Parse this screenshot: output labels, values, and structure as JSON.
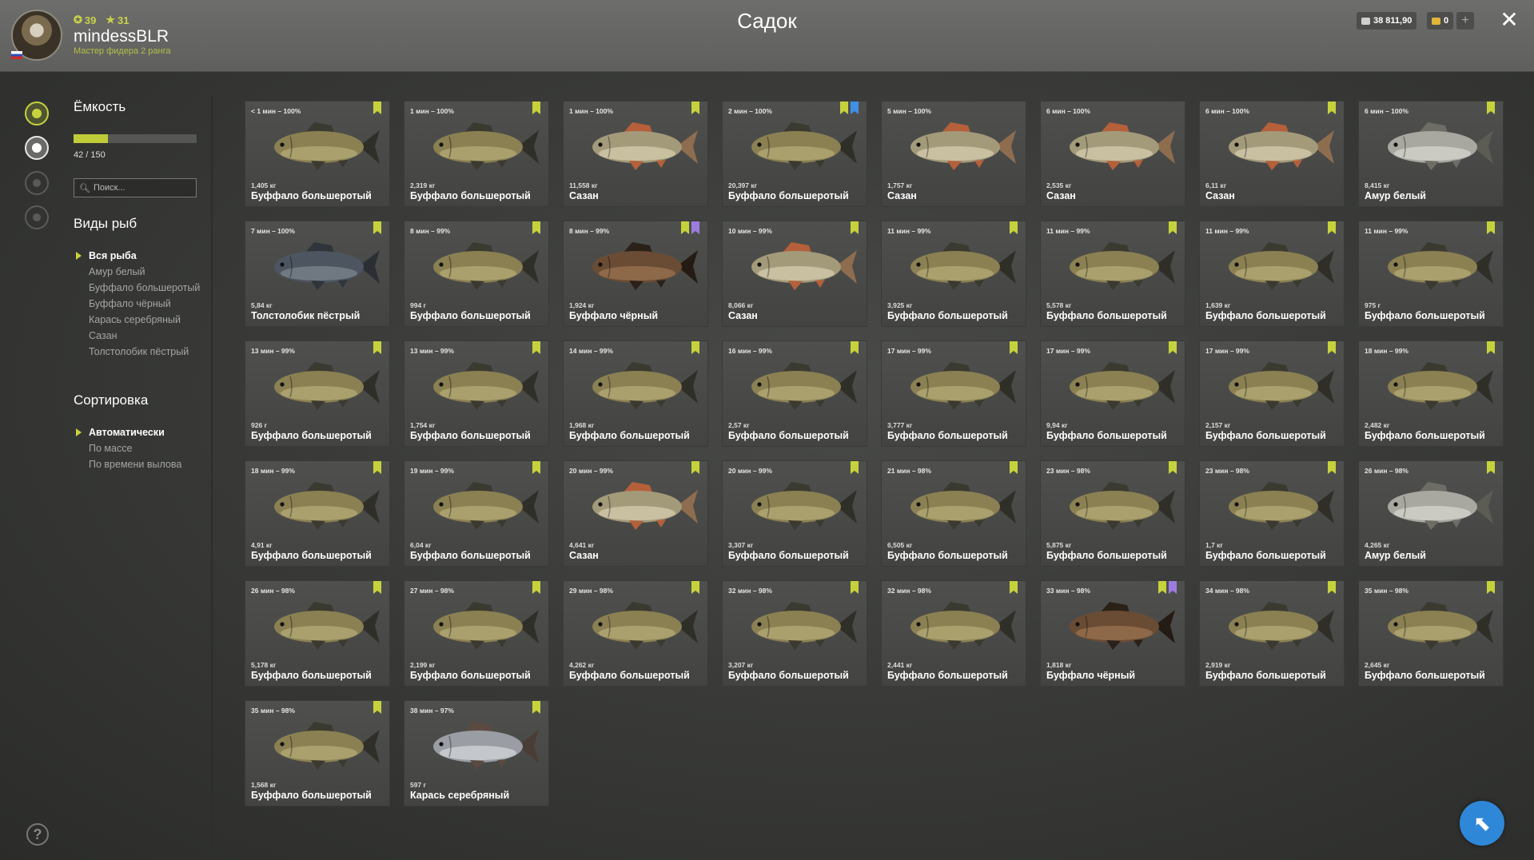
{
  "window": {
    "title": "Садок"
  },
  "player": {
    "username": "mindessBLR",
    "rank": "Мастер фидера 2 ранга",
    "level": "39",
    "stars": "31"
  },
  "currency": {
    "silver": "38 811,90",
    "gold": "0",
    "add_label": "+"
  },
  "sidebar": {
    "capacity_title": "Ёмкость",
    "capacity_count": "42 / 150",
    "capacity_fraction": 0.28,
    "search_placeholder": "Поиск...",
    "species_title": "Виды рыб",
    "species": [
      {
        "label": "Вся рыба",
        "selected": true
      },
      {
        "label": "Амур белый",
        "selected": false
      },
      {
        "label": "Буффало большеротый",
        "selected": false
      },
      {
        "label": "Буффало чёрный",
        "selected": false
      },
      {
        "label": "Карась серебряный",
        "selected": false
      },
      {
        "label": "Сазан",
        "selected": false
      },
      {
        "label": "Толстолобик пёстрый",
        "selected": false
      }
    ],
    "sort_title": "Сортировка",
    "sort": [
      {
        "label": "Автоматически",
        "selected": true
      },
      {
        "label": "По массе",
        "selected": false
      },
      {
        "label": "По времени вылова",
        "selected": false
      }
    ]
  },
  "fish": [
    {
      "time": "< 1 мин – 100%",
      "weight": "1,405 кг",
      "name": "Буффало большеротый",
      "kind": "buffalo",
      "tags": [
        "green"
      ]
    },
    {
      "time": "1 мин – 100%",
      "weight": "2,319 кг",
      "name": "Буффало большеротый",
      "kind": "buffalo",
      "tags": [
        "green"
      ]
    },
    {
      "time": "1 мин – 100%",
      "weight": "11,558 кг",
      "name": "Сазан",
      "kind": "carp",
      "tags": [
        "green"
      ]
    },
    {
      "time": "2 мин – 100%",
      "weight": "20,397 кг",
      "name": "Буффало большеротый",
      "kind": "buffalo",
      "tags": [
        "green",
        "blue"
      ]
    },
    {
      "time": "5 мин – 100%",
      "weight": "1,757 кг",
      "name": "Сазан",
      "kind": "carp",
      "tags": []
    },
    {
      "time": "6 мин – 100%",
      "weight": "2,535 кг",
      "name": "Сазан",
      "kind": "carp",
      "tags": []
    },
    {
      "time": "6 мин – 100%",
      "weight": "6,11 кг",
      "name": "Сазан",
      "kind": "carp",
      "tags": [
        "green"
      ]
    },
    {
      "time": "6 мин – 100%",
      "weight": "8,415 кг",
      "name": "Амур белый",
      "kind": "amur",
      "tags": [
        "green"
      ]
    },
    {
      "time": "7 мин – 100%",
      "weight": "5,84 кг",
      "name": "Толстолобик пёстрый",
      "kind": "bighead",
      "tags": [
        "green"
      ]
    },
    {
      "time": "8 мин – 99%",
      "weight": "994 г",
      "name": "Буффало большеротый",
      "kind": "buffalo",
      "tags": [
        "green"
      ]
    },
    {
      "time": "8 мин – 99%",
      "weight": "1,924 кг",
      "name": "Буффало чёрный",
      "kind": "black",
      "tags": [
        "green",
        "purple"
      ]
    },
    {
      "time": "10 мин – 99%",
      "weight": "8,066 кг",
      "name": "Сазан",
      "kind": "carp",
      "tags": [
        "green"
      ]
    },
    {
      "time": "11 мин – 99%",
      "weight": "3,925 кг",
      "name": "Буффало большеротый",
      "kind": "buffalo",
      "tags": [
        "green"
      ]
    },
    {
      "time": "11 мин – 99%",
      "weight": "5,578 кг",
      "name": "Буффало большеротый",
      "kind": "buffalo",
      "tags": [
        "green"
      ]
    },
    {
      "time": "11 мин – 99%",
      "weight": "1,639 кг",
      "name": "Буффало большеротый",
      "kind": "buffalo",
      "tags": [
        "green"
      ]
    },
    {
      "time": "11 мин – 99%",
      "weight": "975 г",
      "name": "Буффало большеротый",
      "kind": "buffalo",
      "tags": [
        "green"
      ]
    },
    {
      "time": "13 мин – 99%",
      "weight": "926 г",
      "name": "Буффало большеротый",
      "kind": "buffalo",
      "tags": [
        "green"
      ]
    },
    {
      "time": "13 мин – 99%",
      "weight": "1,754 кг",
      "name": "Буффало большеротый",
      "kind": "buffalo",
      "tags": [
        "green"
      ]
    },
    {
      "time": "14 мин – 99%",
      "weight": "1,968 кг",
      "name": "Буффало большеротый",
      "kind": "buffalo",
      "tags": [
        "green"
      ]
    },
    {
      "time": "16 мин – 99%",
      "weight": "2,57 кг",
      "name": "Буффало большеротый",
      "kind": "buffalo",
      "tags": [
        "green"
      ]
    },
    {
      "time": "17 мин – 99%",
      "weight": "3,777 кг",
      "name": "Буффало большеротый",
      "kind": "buffalo",
      "tags": [
        "green"
      ]
    },
    {
      "time": "17 мин – 99%",
      "weight": "9,94 кг",
      "name": "Буффало большеротый",
      "kind": "buffalo",
      "tags": [
        "green"
      ]
    },
    {
      "time": "17 мин – 99%",
      "weight": "2,157 кг",
      "name": "Буффало большеротый",
      "kind": "buffalo",
      "tags": [
        "green"
      ]
    },
    {
      "time": "18 мин – 99%",
      "weight": "2,482 кг",
      "name": "Буффало большеротый",
      "kind": "buffalo",
      "tags": [
        "green"
      ]
    },
    {
      "time": "18 мин – 99%",
      "weight": "4,91 кг",
      "name": "Буффало большеротый",
      "kind": "buffalo",
      "tags": [
        "green"
      ]
    },
    {
      "time": "19 мин – 99%",
      "weight": "6,04 кг",
      "name": "Буффало большеротый",
      "kind": "buffalo",
      "tags": [
        "green"
      ]
    },
    {
      "time": "20 мин – 99%",
      "weight": "4,641 кг",
      "name": "Сазан",
      "kind": "carp",
      "tags": [
        "green"
      ]
    },
    {
      "time": "20 мин – 99%",
      "weight": "3,307 кг",
      "name": "Буффало большеротый",
      "kind": "buffalo",
      "tags": [
        "green"
      ]
    },
    {
      "time": "21 мин – 98%",
      "weight": "6,505 кг",
      "name": "Буффало большеротый",
      "kind": "buffalo",
      "tags": [
        "green"
      ]
    },
    {
      "time": "23 мин – 98%",
      "weight": "5,875 кг",
      "name": "Буффало большеротый",
      "kind": "buffalo",
      "tags": [
        "green"
      ]
    },
    {
      "time": "23 мин – 98%",
      "weight": "1,7 кг",
      "name": "Буффало большеротый",
      "kind": "buffalo",
      "tags": [
        "green"
      ]
    },
    {
      "time": "26 мин – 98%",
      "weight": "4,265 кг",
      "name": "Амур белый",
      "kind": "amur",
      "tags": [
        "green"
      ]
    },
    {
      "time": "26 мин – 98%",
      "weight": "5,178 кг",
      "name": "Буффало большеротый",
      "kind": "buffalo",
      "tags": [
        "green"
      ]
    },
    {
      "time": "27 мин – 98%",
      "weight": "2,199 кг",
      "name": "Буффало большеротый",
      "kind": "buffalo",
      "tags": [
        "green"
      ]
    },
    {
      "time": "29 мин – 98%",
      "weight": "4,262 кг",
      "name": "Буффало большеротый",
      "kind": "buffalo",
      "tags": [
        "green"
      ]
    },
    {
      "time": "32 мин – 98%",
      "weight": "3,207 кг",
      "name": "Буффало большеротый",
      "kind": "buffalo",
      "tags": [
        "green"
      ]
    },
    {
      "time": "32 мин – 98%",
      "weight": "2,441 кг",
      "name": "Буффало большеротый",
      "kind": "buffalo",
      "tags": [
        "green"
      ]
    },
    {
      "time": "33 мин – 98%",
      "weight": "1,818 кг",
      "name": "Буффало чёрный",
      "kind": "black",
      "tags": [
        "green",
        "purple"
      ]
    },
    {
      "time": "34 мин – 98%",
      "weight": "2,919 кг",
      "name": "Буффало большеротый",
      "kind": "buffalo",
      "tags": [
        "green"
      ]
    },
    {
      "time": "35 мин – 98%",
      "weight": "2,645 кг",
      "name": "Буффало большеротый",
      "kind": "buffalo",
      "tags": [
        "green"
      ]
    },
    {
      "time": "35 мин – 98%",
      "weight": "1,568 кг",
      "name": "Буффало большеротый",
      "kind": "buffalo",
      "tags": [
        "green"
      ]
    },
    {
      "time": "38 мин – 97%",
      "weight": "597 г",
      "name": "Карась серебряный",
      "kind": "crucian",
      "tags": [
        "green"
      ]
    }
  ],
  "colors": {
    "accent": "#c8d23f",
    "tag_green": "#c6d23b",
    "tag_blue": "#3f8fe6",
    "tag_purple": "#9d7ce0"
  },
  "icons": [
    "avatar",
    "level-icon",
    "star-icon",
    "silver-coin-icon",
    "gold-coin-icon",
    "plus-icon",
    "close-icon",
    "keepnet-icon",
    "fish-icon",
    "tackle-icon",
    "gear-icon",
    "search-icon",
    "help-icon",
    "cursor-icon",
    "bookmark-icon"
  ]
}
